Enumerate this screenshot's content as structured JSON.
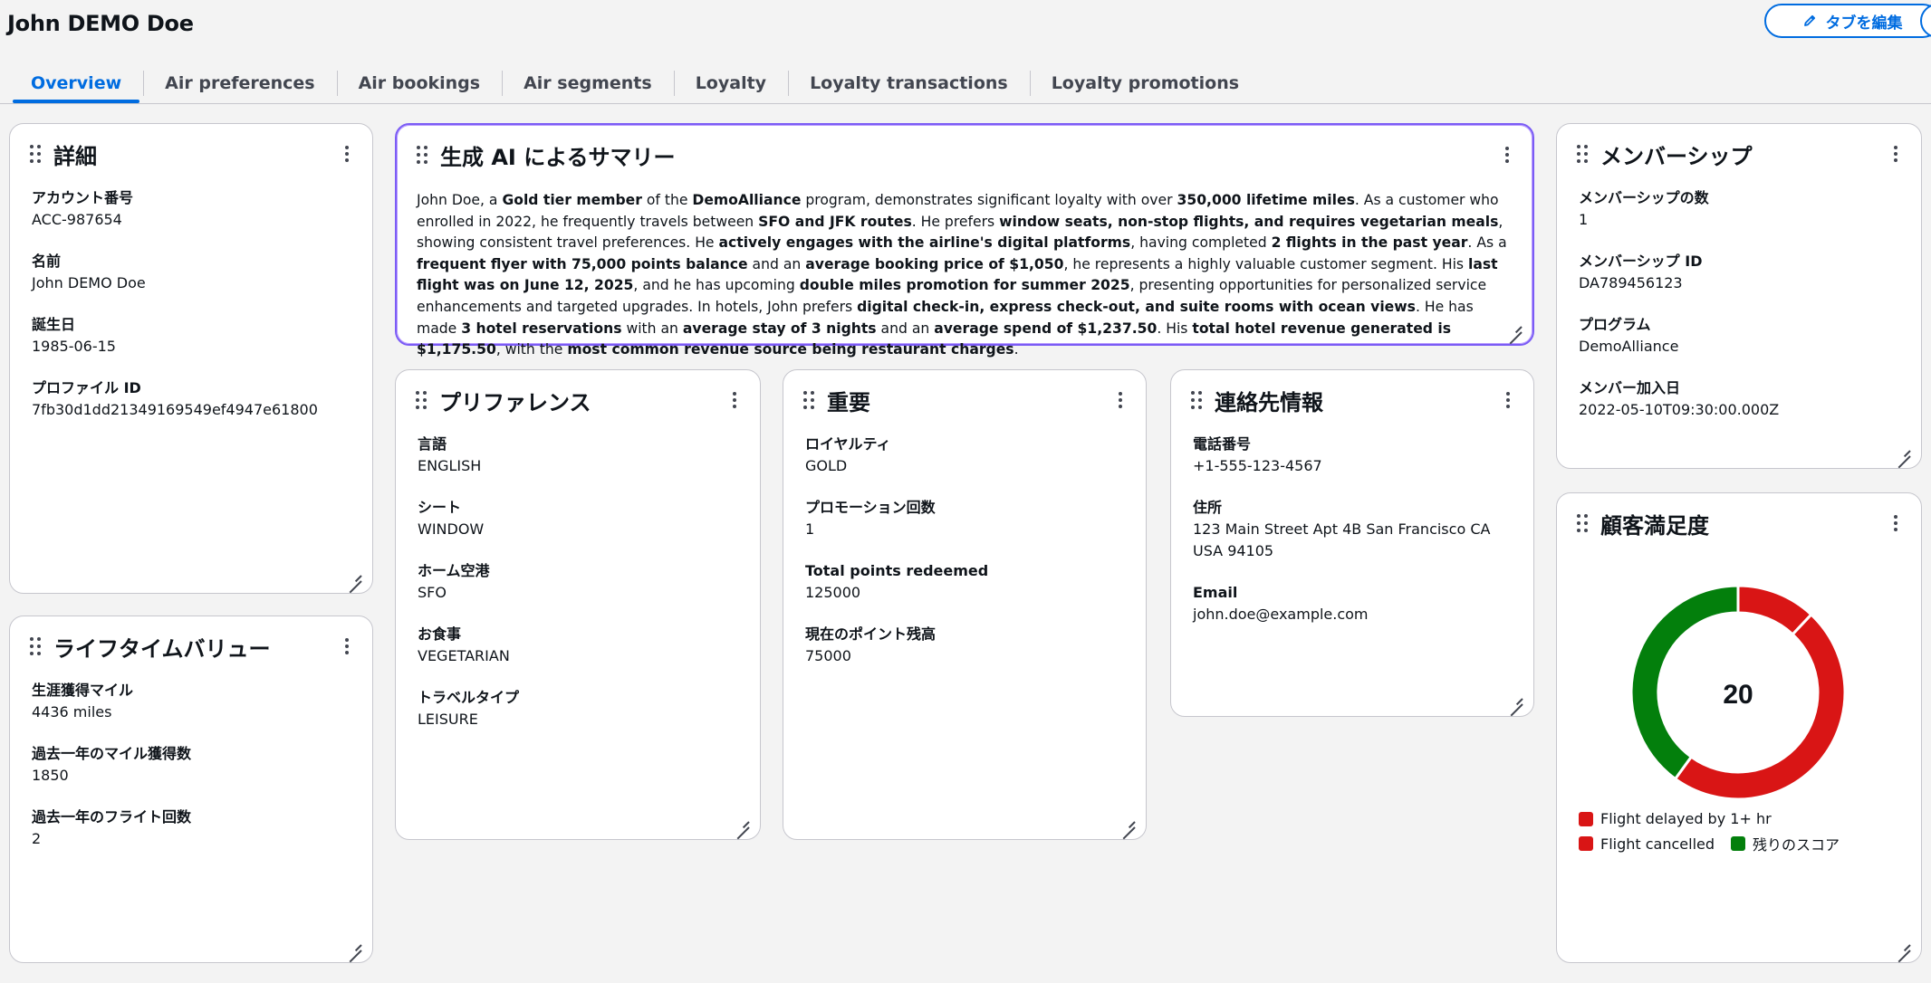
{
  "header": {
    "title": "John DEMO Doe",
    "edit_tabs_label": "タブを編集"
  },
  "tabs": [
    {
      "label": "Overview",
      "active": true
    },
    {
      "label": "Air preferences"
    },
    {
      "label": "Air bookings"
    },
    {
      "label": "Air segments"
    },
    {
      "label": "Loyalty"
    },
    {
      "label": "Loyalty transactions"
    },
    {
      "label": "Loyalty promotions"
    }
  ],
  "details": {
    "title": "詳細",
    "fields": [
      {
        "label": "アカウント番号",
        "value": "ACC-987654"
      },
      {
        "label": "名前",
        "value": "John DEMO Doe"
      },
      {
        "label": "誕生日",
        "value": "1985-06-15"
      },
      {
        "label": "プロファイル ID",
        "value": "7fb30d1dd21349169549ef4947e61800"
      }
    ]
  },
  "lifetime_value": {
    "title": "ライフタイムバリュー",
    "fields": [
      {
        "label": "生涯獲得マイル",
        "value": "4436 miles"
      },
      {
        "label": "過去一年のマイル獲得数",
        "value": "1850"
      },
      {
        "label": "過去一年のフライト回数",
        "value": "2"
      }
    ]
  },
  "ai_summary": {
    "title": "生成 AI によるサマリー",
    "segments": [
      {
        "text": "John Doe, a "
      },
      {
        "text": "Gold tier member",
        "bold": true
      },
      {
        "text": " of the "
      },
      {
        "text": "DemoAlliance",
        "bold": true
      },
      {
        "text": " program, demonstrates significant loyalty with over "
      },
      {
        "text": "350,000 lifetime miles",
        "bold": true
      },
      {
        "text": ". As a customer who enrolled in 2022, he frequently travels between "
      },
      {
        "text": "SFO and JFK routes",
        "bold": true
      },
      {
        "text": ". He prefers "
      },
      {
        "text": "window seats, non-stop flights, and requires vegetarian meals",
        "bold": true
      },
      {
        "text": ", showing consistent travel preferences. He "
      },
      {
        "text": "actively engages with the airline's digital platforms",
        "bold": true
      },
      {
        "text": ", having completed "
      },
      {
        "text": "2 flights in the past year",
        "bold": true
      },
      {
        "text": ". As a "
      },
      {
        "text": "frequent flyer with 75,000 points balance",
        "bold": true
      },
      {
        "text": " and an "
      },
      {
        "text": "average booking price of $1,050",
        "bold": true
      },
      {
        "text": ", he represents a highly valuable customer segment. His "
      },
      {
        "text": "last flight was on June 12, 2025",
        "bold": true
      },
      {
        "text": ", and he has upcoming "
      },
      {
        "text": "double miles promotion for summer 2025",
        "bold": true
      },
      {
        "text": ", presenting opportunities for personalized service enhancements and targeted upgrades. In hotels, John prefers "
      },
      {
        "text": "digital check-in, express check-out, and suite rooms with ocean views",
        "bold": true
      },
      {
        "text": ". He has made "
      },
      {
        "text": "3 hotel reservations",
        "bold": true
      },
      {
        "text": " with an "
      },
      {
        "text": "average stay of 3 nights",
        "bold": true
      },
      {
        "text": " and an "
      },
      {
        "text": "average spend of $1,237.50",
        "bold": true
      },
      {
        "text": ". His "
      },
      {
        "text": "total hotel revenue generated is $1,175.50",
        "bold": true
      },
      {
        "text": ", with the "
      },
      {
        "text": "most common revenue source being restaurant charges",
        "bold": true
      },
      {
        "text": "."
      }
    ]
  },
  "preferences": {
    "title": "プリファレンス",
    "fields": [
      {
        "label": "言語",
        "value": "ENGLISH"
      },
      {
        "label": "シート",
        "value": "WINDOW"
      },
      {
        "label": "ホーム空港",
        "value": "SFO"
      },
      {
        "label": "お食事",
        "value": "VEGETARIAN"
      },
      {
        "label": "トラベルタイプ",
        "value": "LEISURE"
      }
    ]
  },
  "important": {
    "title": "重要",
    "fields": [
      {
        "label": "ロイヤルティ",
        "value": "GOLD"
      },
      {
        "label": "プロモーション回数",
        "value": "1"
      },
      {
        "label": "Total points redeemed",
        "value": "125000"
      },
      {
        "label": "現在のポイント残高",
        "value": "75000"
      }
    ]
  },
  "contact": {
    "title": "連絡先情報",
    "fields": [
      {
        "label": "電話番号",
        "value": "+1-555-123-4567"
      },
      {
        "label": "住所",
        "value": "123 Main Street Apt 4B San Francisco CA USA 94105"
      },
      {
        "label": "Email",
        "value": "john.doe@example.com"
      }
    ]
  },
  "membership": {
    "title": "メンバーシップ",
    "fields": [
      {
        "label": "メンバーシップの数",
        "value": "1"
      },
      {
        "label": "メンバーシップ ID",
        "value": "DA789456123"
      },
      {
        "label": "プログラム",
        "value": "DemoAlliance"
      },
      {
        "label": "メンバー加入日",
        "value": "2022-05-10T09:30:00.000Z"
      }
    ]
  },
  "satisfaction": {
    "title": "顧客満足度",
    "center_value": "20",
    "colors": {
      "red": "#d91515",
      "green": "#037f0c"
    }
  },
  "chart_data": {
    "type": "pie",
    "donut": true,
    "center_label": "20",
    "slices": [
      {
        "label": "Flight delayed by 1+ hr",
        "value": 12,
        "color": "#d91515"
      },
      {
        "label": "Flight cancelled",
        "value": 48,
        "color": "#d91515"
      },
      {
        "label": "残りのスコア",
        "value": 40,
        "color": "#037f0c"
      }
    ],
    "legend": [
      {
        "label": "Flight delayed by 1+ hr",
        "color": "#d91515"
      },
      {
        "label": "Flight cancelled",
        "color": "#d91515"
      },
      {
        "label": "残りのスコア",
        "color": "#037f0c"
      }
    ],
    "legend_position": "bottom"
  }
}
